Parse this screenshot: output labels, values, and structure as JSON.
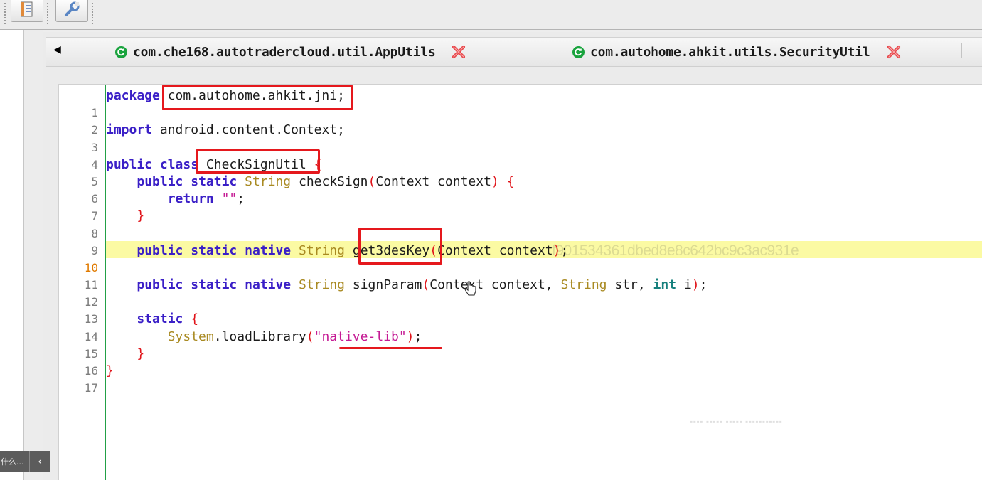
{
  "toolbar": {
    "buttons": [
      {
        "name": "outline-button",
        "icon": "document-outline-icon"
      },
      {
        "name": "settings-button",
        "icon": "wrench-icon"
      }
    ]
  },
  "side_overlay": {
    "label": "什么...",
    "collapse_icon": "chevron-left-icon"
  },
  "tabs": {
    "scroll_left_glyph": "◀",
    "items": [
      {
        "label": "com.che168.autotradercloud.util.AppUtils",
        "icon": "class-refresh-icon",
        "close_icon": "close-icon"
      },
      {
        "label": "com.autohome.ahkit.utils.SecurityUtil",
        "icon": "class-refresh-icon",
        "close_icon": "close-icon"
      }
    ]
  },
  "editor": {
    "current_line": 10,
    "line_numbers": [
      "1",
      "2",
      "3",
      "4",
      "5",
      "6",
      "7",
      "8",
      "9",
      "10",
      "11",
      "12",
      "13",
      "14",
      "15",
      "16",
      "17"
    ],
    "tokens": {
      "l1": [
        "package",
        " com.autohome.ahkit.jni;"
      ],
      "l3": [
        "import",
        " android.content.Context;"
      ],
      "l5": [
        "public",
        " ",
        "class",
        " CheckSignUtil ",
        "{"
      ],
      "l6": [
        "    ",
        "public",
        " ",
        "static",
        " ",
        "String",
        " checkSign",
        "(",
        "Context context",
        ")",
        " ",
        "{"
      ],
      "l7": [
        "        ",
        "return",
        " ",
        "\"\"",
        ";"
      ],
      "l8": [
        "    ",
        "}"
      ],
      "l10": [
        "    ",
        "public",
        " ",
        "static",
        " ",
        "native",
        " ",
        "String",
        " get3desKey",
        "(",
        "Context context",
        ")",
        ";"
      ],
      "l12": [
        "    ",
        "public",
        " ",
        "static",
        " ",
        "native",
        " ",
        "String",
        " signParam",
        "(",
        "Context context, ",
        "String",
        " str, ",
        "int",
        " i",
        ")",
        ";"
      ],
      "l14": [
        "    ",
        "static",
        " ",
        "{"
      ],
      "l15": [
        "        ",
        "System",
        ".loadLibrary",
        "(",
        "\"native-lib\"",
        ")",
        ";"
      ],
      "l16": [
        "    ",
        "}"
      ],
      "l17": [
        "}"
      ]
    }
  },
  "annotations": {
    "color": "#e5181d",
    "watermark_hash": "f901534361dbed8e8c642bc9c3ac931e"
  },
  "colors": {
    "keyword": "#3a1fc7",
    "type": "#a98a22",
    "brace": "#e0141a",
    "string": "#c51a94",
    "primitive": "#16807d",
    "current_line_bg": "#fbfaa3",
    "gutter": "#22a046"
  }
}
